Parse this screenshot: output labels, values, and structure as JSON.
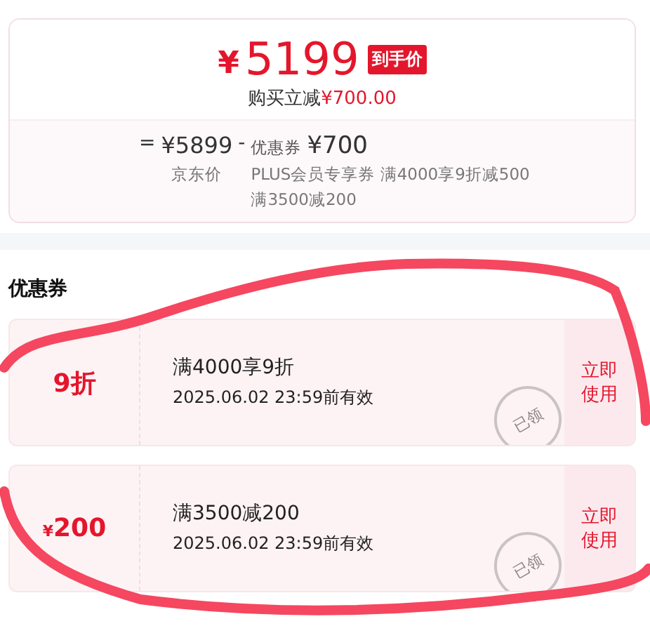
{
  "price_card": {
    "final_price_symbol": "¥",
    "final_price": "5199",
    "price_tag": "到手价",
    "saving_label": "购买立减",
    "saving_amount": "¥700.00",
    "breakdown": {
      "equals": "=",
      "base_price": "¥5899",
      "base_label": "京东价",
      "minus": "-",
      "coupon_label": "优惠券",
      "coupon_amount": "¥700",
      "details": [
        "PLUS会员专享券 满4000享9折减500",
        "满3500减200"
      ]
    }
  },
  "coupons_title": "优惠券",
  "coupons": [
    {
      "kind": "discount",
      "value": "9折",
      "condition": "满4000享9折",
      "validity": "2025.06.02 23:59前有效",
      "action": "立即使用",
      "stamp": "已领"
    },
    {
      "kind": "cash",
      "symbol": "¥",
      "value": "200",
      "condition": "满3500减200",
      "validity": "2025.06.02 23:59前有效",
      "action": "立即使用",
      "stamp": "已领"
    }
  ]
}
